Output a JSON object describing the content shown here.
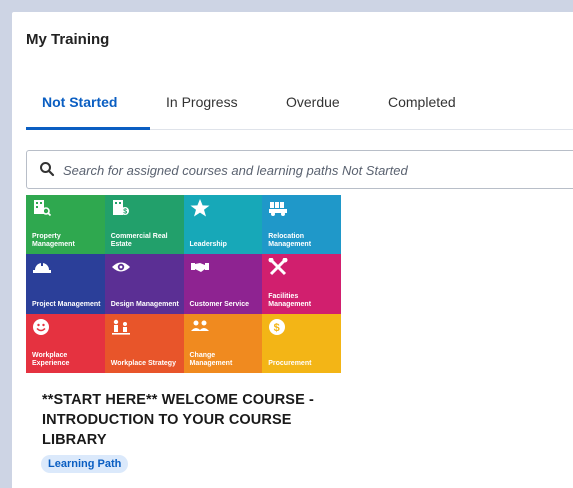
{
  "header": {
    "title": "My Training"
  },
  "tabs": [
    {
      "label": "Not Started",
      "active": true
    },
    {
      "label": "In Progress",
      "active": false
    },
    {
      "label": "Overdue",
      "active": false
    },
    {
      "label": "Completed",
      "active": false
    }
  ],
  "search": {
    "placeholder": "Search for assigned courses and learning paths Not Started",
    "icon": "search-icon"
  },
  "course": {
    "title": "**START HERE** WELCOME COURSE - INTRODUCTION TO YOUR COURSE LIBRARY",
    "badge": "Learning Path",
    "tiles": [
      {
        "label": "Property Management",
        "color": "#2fa84f",
        "icon": "building-search-icon"
      },
      {
        "label": "Commercial Real Estate",
        "color": "#22a06b",
        "icon": "building-dollar-icon"
      },
      {
        "label": "Leadership",
        "color": "#17a8b8",
        "icon": "star-icon"
      },
      {
        "label": "Relocation Management",
        "color": "#1f98c9",
        "icon": "truck-icon"
      },
      {
        "label": "Project Management",
        "color": "#2b3f99",
        "icon": "hard-hat-icon"
      },
      {
        "label": "Design Management",
        "color": "#5b2f94",
        "icon": "eye-icon"
      },
      {
        "label": "Customer Service",
        "color": "#8e2391",
        "icon": "handshake-icon"
      },
      {
        "label": "Facilities Management",
        "color": "#d11f6e",
        "icon": "tools-icon"
      },
      {
        "label": "Workplace Experience",
        "color": "#e53240",
        "icon": "smiley-icon"
      },
      {
        "label": "Workplace Strategy",
        "color": "#e8552a",
        "icon": "people-strategy-icon"
      },
      {
        "label": "Change Management",
        "color": "#f08a1f",
        "icon": "group-icon"
      },
      {
        "label": "Procurement",
        "color": "#f3b516",
        "icon": "coin-icon"
      }
    ]
  },
  "colors": {
    "accent": "#0a5ec2",
    "background": "#cdd4e4",
    "badge_bg": "#dbe9fb"
  }
}
